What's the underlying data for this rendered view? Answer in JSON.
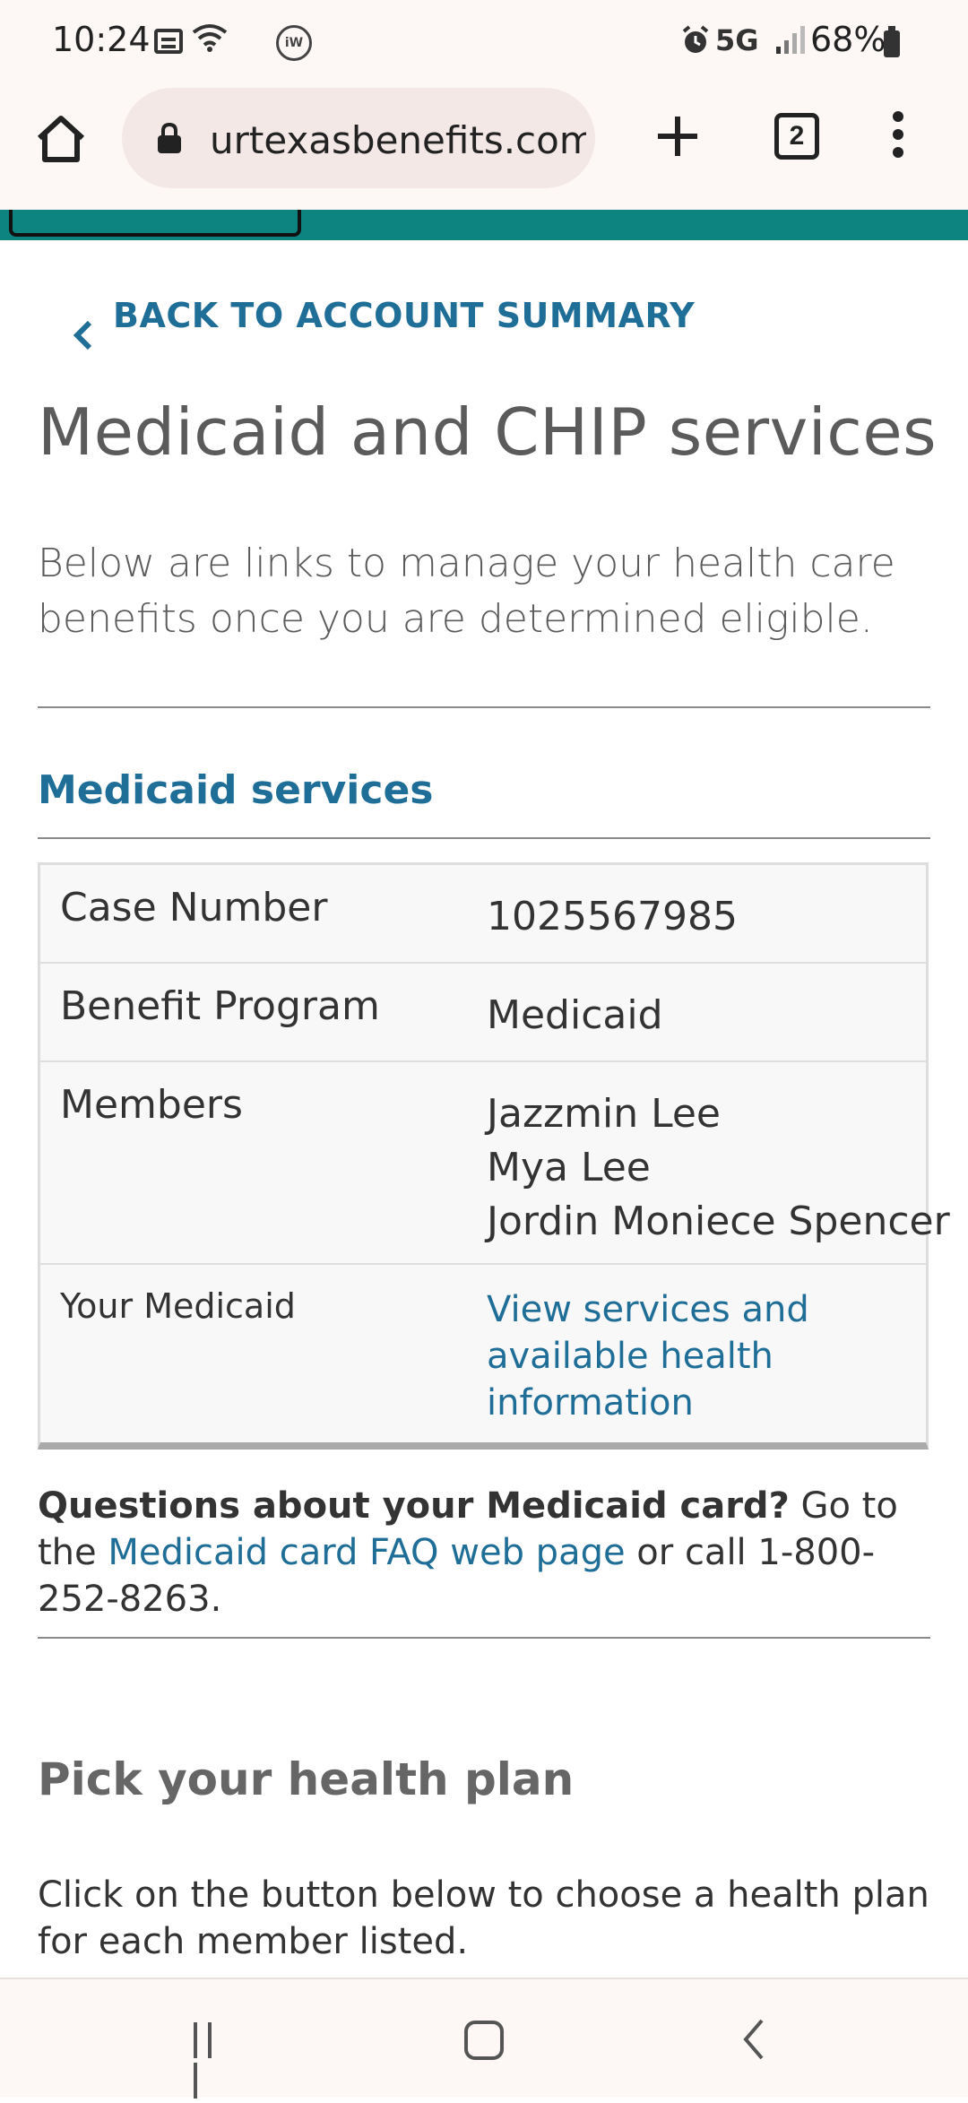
{
  "status_bar": {
    "time": "10:24",
    "network": "5G",
    "battery": "68%",
    "iw_badge": "iW"
  },
  "browser": {
    "url": "urtexasbenefits.com",
    "tab_count": "2"
  },
  "page": {
    "back_link": "BACK TO ACCOUNT SUMMARY",
    "title": "Medicaid and CHIP services",
    "intro": "Below are links to manage your health care benefits once you are determined eligible.",
    "section_title": "Medicaid services",
    "table": {
      "case_label": "Case Number",
      "case_value": "1025567985",
      "program_label": "Benefit Program",
      "program_value": "Medicaid",
      "members_label": "Members",
      "members": [
        "Jazzmin Lee",
        "Mya Lee",
        "Jordin Moniece Spencer"
      ],
      "your_label": "Your Medicaid",
      "your_link": "View services and available health information"
    },
    "questions": {
      "bold": "Questions about your Medicaid card?",
      "pre_link": " Go to the ",
      "link": "Medicaid card FAQ web page",
      "post_link": " or call 1-800-252-8263."
    },
    "pick_title": "Pick your health plan",
    "pick_text": "Click on the button below to choose a health plan for each member listed."
  },
  "colors": {
    "link": "#1f6e97",
    "teal": "#0e8481"
  }
}
